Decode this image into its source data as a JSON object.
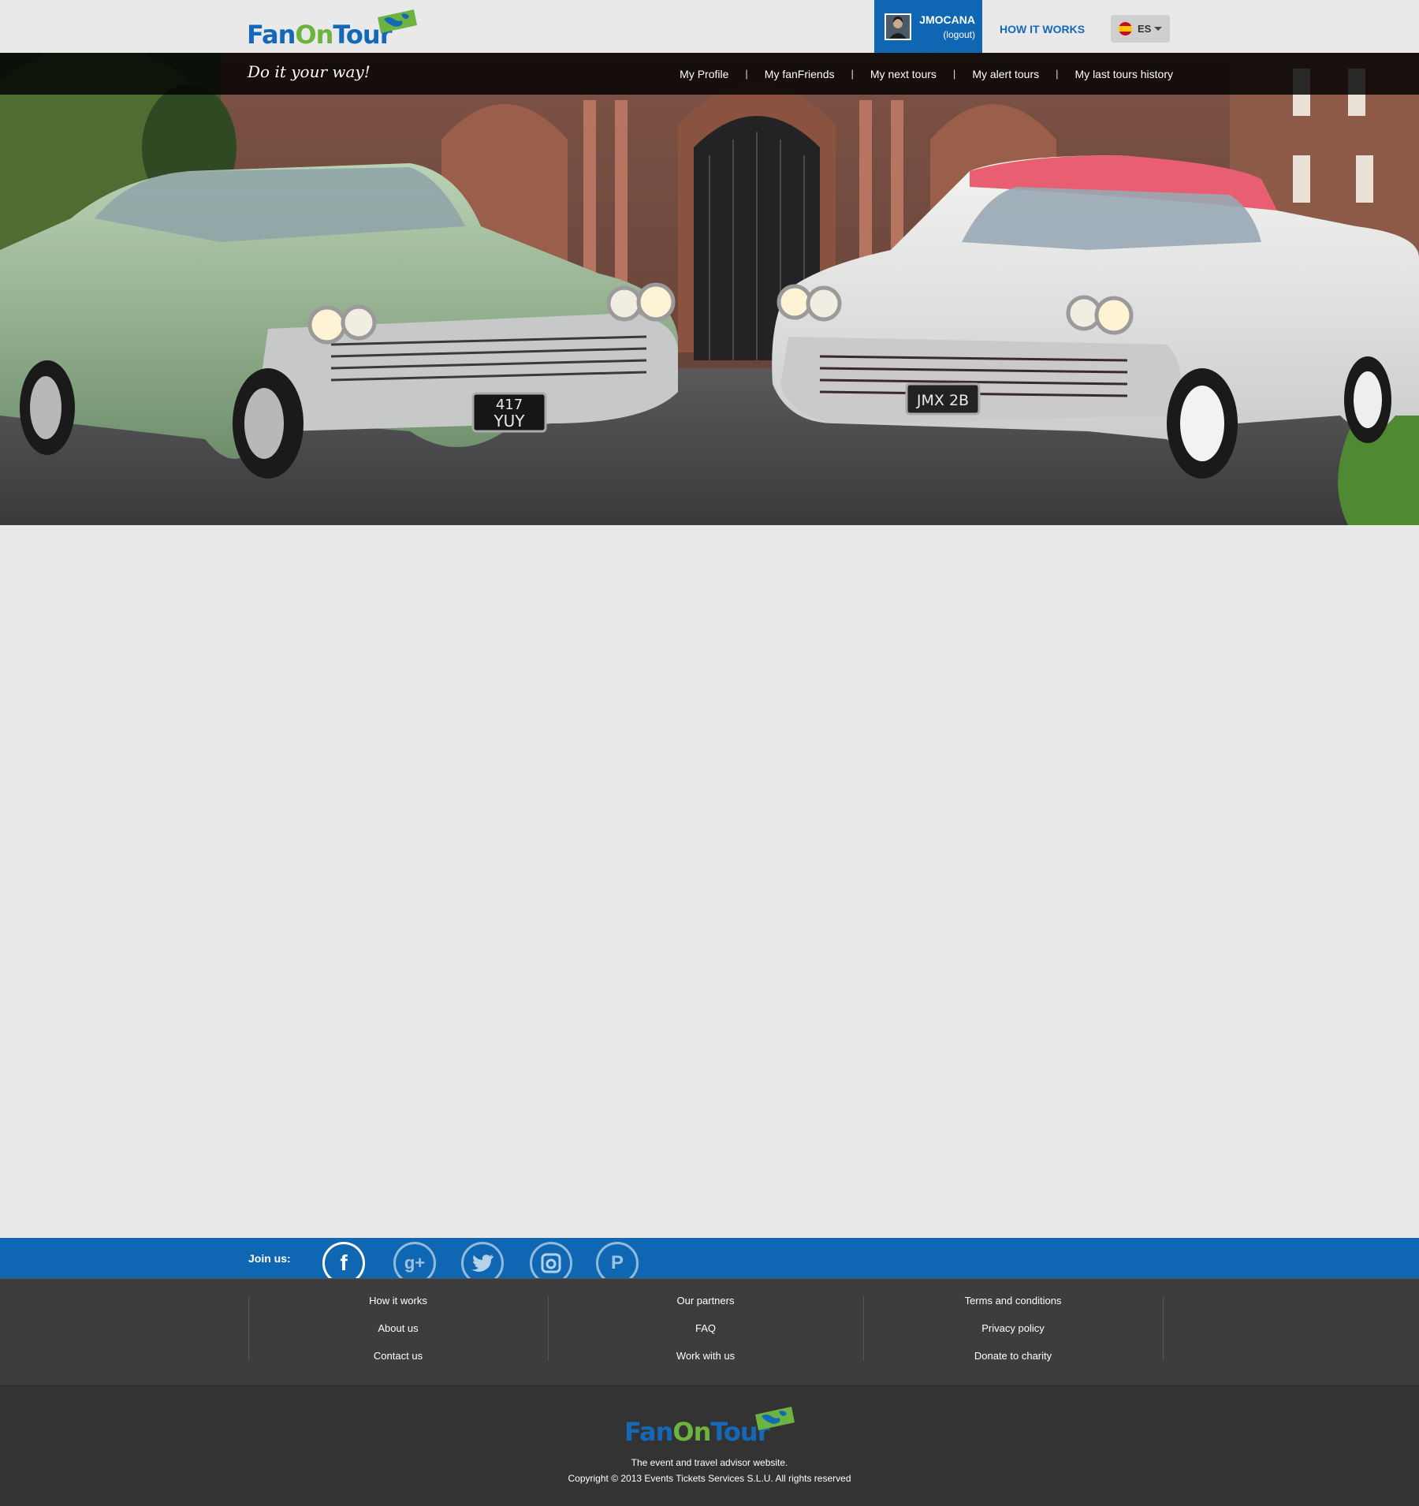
{
  "brand": {
    "logo_part1": "Fan",
    "logo_part2": "On",
    "logo_part3": "Tour",
    "tagline": "Do it your way!",
    "colors": {
      "blue": "#0f67b3",
      "green": "#6cb33f",
      "dark": "#333333"
    }
  },
  "header": {
    "username": "JMOCANA",
    "logout_label": "(logout)",
    "how_it_works": "HOW IT WORKS",
    "language": "ES",
    "language_icon": "spain-flag-icon"
  },
  "subnav": {
    "items": [
      {
        "label": "My Profile"
      },
      {
        "label": "My fanFriends"
      },
      {
        "label": "My next tours"
      },
      {
        "label": "My alert tours"
      },
      {
        "label": "My last tours history"
      }
    ],
    "separator": "|"
  },
  "hero": {
    "plate_left_1": "417",
    "plate_left_2": "YUY",
    "plate_right": "JMX 2B"
  },
  "social": {
    "join_label": "Join us:",
    "icons": [
      {
        "name": "facebook-icon",
        "glyph": "f"
      },
      {
        "name": "google-plus-icon",
        "glyph": "g+"
      },
      {
        "name": "twitter-icon",
        "glyph": "🐦"
      },
      {
        "name": "instagram-icon",
        "glyph": "◙"
      },
      {
        "name": "pinterest-icon",
        "glyph": "P"
      }
    ]
  },
  "footer": {
    "col1": [
      "How it works",
      "About us",
      "Contact us"
    ],
    "col2": [
      "Our partners",
      "FAQ",
      "Work with us"
    ],
    "col3": [
      "Terms and conditions",
      "Privacy policy",
      "Donate to charity"
    ],
    "tagline": "The event and travel advisor website.",
    "copyright": "Copyright © 2013 Events Tickets Services S.L.U. All rights reserved"
  }
}
